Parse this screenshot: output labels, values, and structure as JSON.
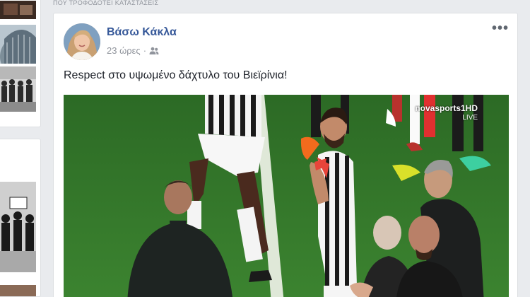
{
  "top_strip_text": "ΠΟΥ ΤΡΟΦΟΔΟΤΕΙ ΚΑΤΑΣΤΑΣΕΙΣ",
  "post": {
    "author": "Βάσω Κάκλα",
    "timestamp": "23 ώρες",
    "separator": "·",
    "privacy_icon": "friends-icon",
    "text": "Respect στο υψωμένο δάχτυλο του Βιεϊρίνια!",
    "more_label": "•••",
    "photo_watermark": "novasports1HD",
    "photo_watermark_sub": "LIVE"
  },
  "colors": {
    "link": "#365899",
    "page_bg": "#e9ebee",
    "meta_text": "#90949c"
  }
}
